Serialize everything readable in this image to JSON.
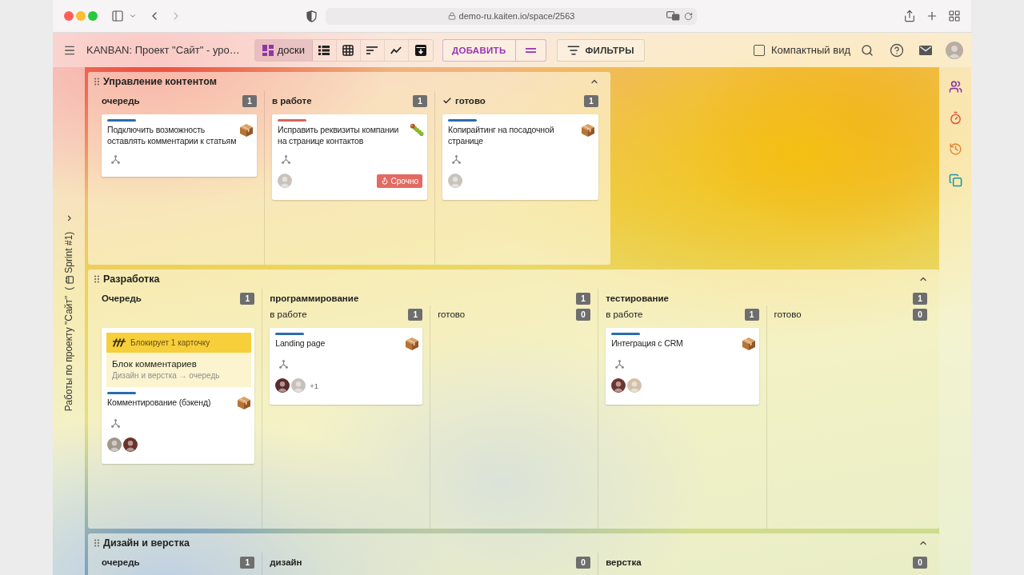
{
  "browser": {
    "url": "demo-ru.kaiten.io/space/2563"
  },
  "toolbar": {
    "title": "KANBAN: Проект \"Сайт\" - уро…",
    "views": [
      {
        "kind": "board",
        "label": "доски",
        "selected": true
      },
      {
        "kind": "list",
        "selected": false
      },
      {
        "kind": "table",
        "selected": false
      },
      {
        "kind": "sort",
        "selected": false
      },
      {
        "kind": "chart",
        "selected": false
      },
      {
        "kind": "archive",
        "selected": false
      }
    ],
    "add_button": "ДОБАВИТЬ",
    "filter_button": "ФИЛЬТРЫ",
    "compact_view": {
      "label": "Компактный вид",
      "checked": false
    }
  },
  "board": {
    "title": "Работы по проекту \"Сайт\"",
    "sprint": {
      "open": "(",
      "label": "Sprint #1)"
    }
  },
  "lanes": [
    {
      "title": "Управление контентом",
      "expanded": true,
      "columns": [
        {
          "kind": "column",
          "title": "очередь",
          "count": "1",
          "done": false,
          "cards": [
            {
              "kind": "task",
              "color": "#2b6cb0",
              "title": "Подключить возможность оставлять комментарии к статьям"
            }
          ]
        },
        {
          "kind": "column",
          "title": "в работе",
          "count": "1",
          "done": false,
          "cards": [
            {
              "kind": "bug",
              "color": "#d8645a",
              "title": "Исправить реквизиты компании на странице контактов",
              "avatars": [
                {
                  "color": "#c9c3bc"
                }
              ],
              "tag": "Срочно"
            }
          ]
        },
        {
          "kind": "column",
          "title": "готово",
          "count": "1",
          "done": true,
          "cards": [
            {
              "kind": "task",
              "color": "#2b6cb0",
              "title": "Копирайтинг на посадочной странице",
              "avatars": [
                {
                  "color": "#c9c3bc"
                }
              ]
            }
          ]
        }
      ]
    },
    {
      "title": "Разработка",
      "expanded": true,
      "columns": [
        {
          "kind": "column",
          "title": "Очередь",
          "count": "1",
          "done": false,
          "cards": [
            {
              "kind": "task",
              "color": "#2b6cb0",
              "blocker": {
                "label": "Блокирует 1 карточку",
                "card": "Блок комментариев",
                "path": "Дизайн и верстка → очередь"
              },
              "title": "Комментирование (бэкенд)",
              "avatars": [
                {
                  "color": "#a3968c"
                },
                {
                  "color": "#6b3328"
                }
              ]
            }
          ]
        },
        {
          "kind": "group",
          "title": "программирование",
          "count": "1",
          "done": false,
          "subcolumns": [
            {
              "title": "в работе",
              "count": "1",
              "done": false,
              "cards": [
                {
                  "kind": "task",
                  "color": "#2b6cb0",
                  "title": "Landing page",
                  "avatars": [
                    {
                      "color": "#5c2a2a"
                    },
                    {
                      "color": "#c6c1ba"
                    }
                  ],
                  "more": "+1"
                }
              ]
            },
            {
              "title": "готово",
              "count": "0",
              "done": false
            }
          ]
        },
        {
          "kind": "group",
          "title": "тестирование",
          "count": "1",
          "done": false,
          "subcolumns": [
            {
              "title": "в работе",
              "count": "1",
              "done": false,
              "cards": [
                {
                  "kind": "task",
                  "color": "#2b6cb0",
                  "title": "Интеграция с CRM",
                  "avatars": [
                    {
                      "color": "#6e3530"
                    },
                    {
                      "color": "#d3c0a8"
                    }
                  ]
                }
              ]
            },
            {
              "title": "готово",
              "count": "0",
              "done": false
            }
          ]
        }
      ]
    },
    {
      "title": "Дизайн и верстка",
      "expanded": true,
      "columns": [
        {
          "kind": "column",
          "title": "очередь",
          "count": "1",
          "done": false
        },
        {
          "kind": "group",
          "title": "дизайн",
          "count": "0",
          "done": false
        },
        {
          "kind": "group",
          "title": "верстка",
          "count": "0",
          "done": false
        }
      ]
    }
  ],
  "right_sidebar": [
    {
      "kind": "members"
    },
    {
      "kind": "timer"
    },
    {
      "kind": "history"
    },
    {
      "kind": "cards"
    }
  ]
}
